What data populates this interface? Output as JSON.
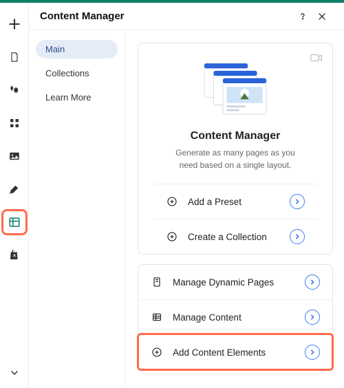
{
  "header": {
    "title": "Content Manager"
  },
  "subnav": {
    "items": [
      {
        "label": "Main",
        "active": true
      },
      {
        "label": "Collections",
        "active": false
      },
      {
        "label": "Learn More",
        "active": false
      }
    ]
  },
  "intro": {
    "title": "Content Manager",
    "subtitle": "Generate as many pages as you need based on a single layout."
  },
  "actions1": [
    {
      "label": "Add a Preset"
    },
    {
      "label": "Create a Collection"
    }
  ],
  "actions2": [
    {
      "label": "Manage Dynamic Pages"
    },
    {
      "label": "Manage Content"
    },
    {
      "label": "Add Content Elements"
    }
  ],
  "rail": {
    "items": [
      "plus",
      "page",
      "drop",
      "grid",
      "image",
      "pen",
      "db",
      "shop"
    ]
  }
}
